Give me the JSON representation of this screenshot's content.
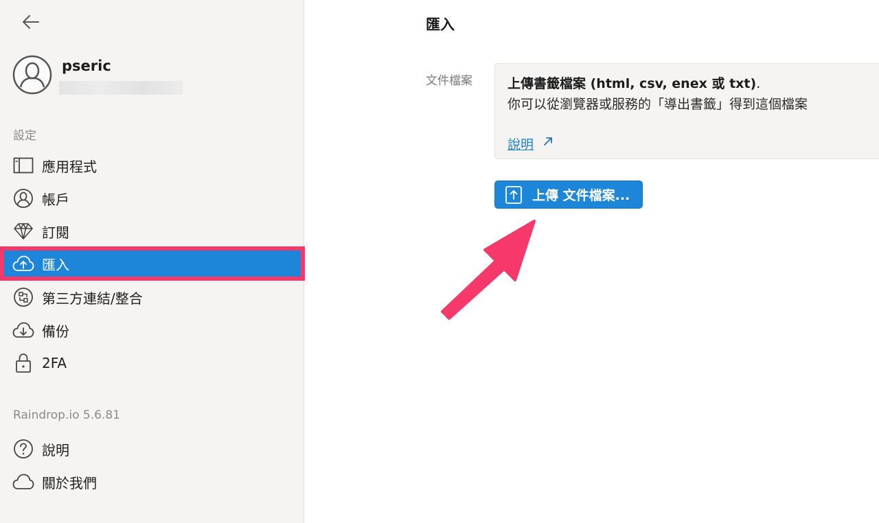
{
  "sidebar": {
    "username": "pseric",
    "section_label": "設定",
    "items": [
      {
        "label": "應用程式",
        "icon": "app-window-icon"
      },
      {
        "label": "帳戶",
        "icon": "user-icon"
      },
      {
        "label": "訂閱",
        "icon": "diamond-icon"
      },
      {
        "label": "匯入",
        "icon": "cloud-upload-icon",
        "active": true
      },
      {
        "label": "第三方連結/整合",
        "icon": "integrations-icon"
      },
      {
        "label": "備份",
        "icon": "cloud-download-icon"
      },
      {
        "label": "2FA",
        "icon": "lock-icon"
      }
    ],
    "version": "Raindrop.io 5.6.81",
    "footer_items": [
      {
        "label": "說明",
        "icon": "help-icon"
      },
      {
        "label": "關於我們",
        "icon": "cloud-icon"
      }
    ]
  },
  "main": {
    "title": "匯入",
    "field_label": "文件檔案",
    "info_title": "上傳書籤檔案 (html, csv, enex 或 txt)",
    "info_title_dot": ".",
    "info_desc": "你可以從瀏覽器或服務的「導出書籤」得到這個檔案",
    "help_link": "說明",
    "upload_button": "上傳 文件檔案..."
  },
  "colors": {
    "accent": "#1e86d8",
    "highlight": "#f6396a",
    "sidebar_bg": "#f5f4f2"
  }
}
